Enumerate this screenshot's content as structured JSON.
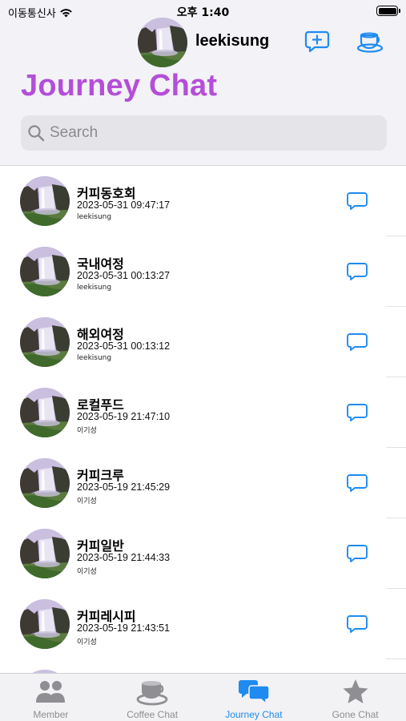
{
  "status_bar": {
    "carrier": "이동통신사",
    "time": "오후 1:40"
  },
  "header": {
    "username": "leekisung",
    "title": "Journey Chat"
  },
  "search": {
    "placeholder": "Search"
  },
  "chats": [
    {
      "title": "커피동호회",
      "date": "2023-05-31 09:47:17",
      "author": "leekisung"
    },
    {
      "title": "국내여정",
      "date": "2023-05-31 00:13:27",
      "author": "leekisung"
    },
    {
      "title": "해외여정",
      "date": "2023-05-31 00:13:12",
      "author": "leekisung"
    },
    {
      "title": "로컬푸드",
      "date": "2023-05-19 21:47:10",
      "author": "이기성"
    },
    {
      "title": "커피크루",
      "date": "2023-05-19 21:45:29",
      "author": "이기성"
    },
    {
      "title": "커피일반",
      "date": "2023-05-19 21:44:33",
      "author": "이기성"
    },
    {
      "title": "커피레시피",
      "date": "2023-05-19 21:43:51",
      "author": "이기성"
    },
    {
      "title": "",
      "date": "",
      "author": ""
    }
  ],
  "tabs": [
    {
      "label": "Member",
      "icon": "people-icon",
      "active": false
    },
    {
      "label": "Coffee Chat",
      "icon": "coffee-cup-icon",
      "active": false
    },
    {
      "label": "Journey Chat",
      "icon": "chat-bubbles-icon",
      "active": true
    },
    {
      "label": "Gone Chat",
      "icon": "star-icon",
      "active": false
    }
  ],
  "colors": {
    "accent": "#1f8bf0",
    "title": "#b44ed9",
    "inactive": "#8e8e93"
  }
}
